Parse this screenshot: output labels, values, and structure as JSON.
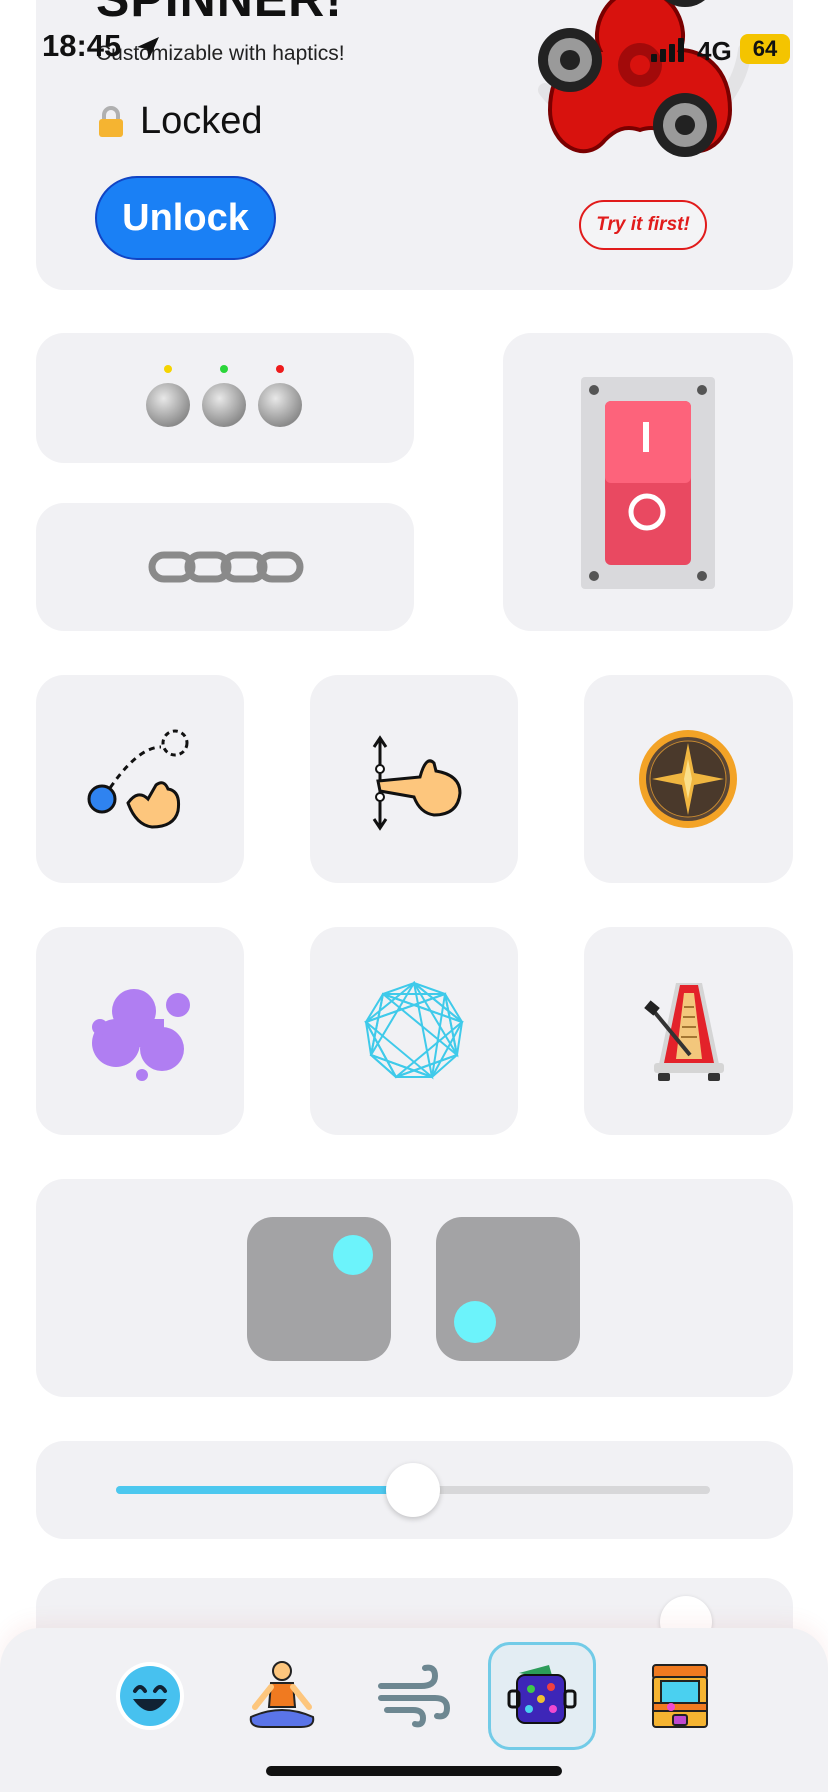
{
  "status_bar": {
    "time": "18:45",
    "network": "4G",
    "battery": "64"
  },
  "spinner_card": {
    "title": "SPINNER!",
    "subtitle": "Customizable with haptics!",
    "lock_status": "Locked",
    "unlock_label": "Unlock",
    "try_label": "Try it first!"
  },
  "slider": {
    "value_percent": 50,
    "accent_color": "#4cc8ef"
  },
  "colors": {
    "card_bg": "#f1f1f4",
    "unlock_blue": "#1a80f5",
    "try_red": "#e11b1b",
    "dot_cyan": "#6cf3fb"
  },
  "tiles": [
    {
      "icon": "buttons-icon"
    },
    {
      "icon": "chain-icon"
    },
    {
      "icon": "power-switch-icon"
    },
    {
      "icon": "swipe-drag-icon"
    },
    {
      "icon": "scroll-gesture-icon"
    },
    {
      "icon": "compass-icon"
    },
    {
      "icon": "blobs-icon"
    },
    {
      "icon": "geometric-mesh-icon"
    },
    {
      "icon": "metronome-icon"
    },
    {
      "icon": "dice-icon"
    },
    {
      "icon": "slider-icon"
    }
  ],
  "tabbar": {
    "items": [
      {
        "icon": "smiley-icon"
      },
      {
        "icon": "meditation-icon"
      },
      {
        "icon": "wind-icon"
      },
      {
        "icon": "fidget-toy-icon",
        "active": true
      },
      {
        "icon": "arcade-icon"
      }
    ]
  }
}
